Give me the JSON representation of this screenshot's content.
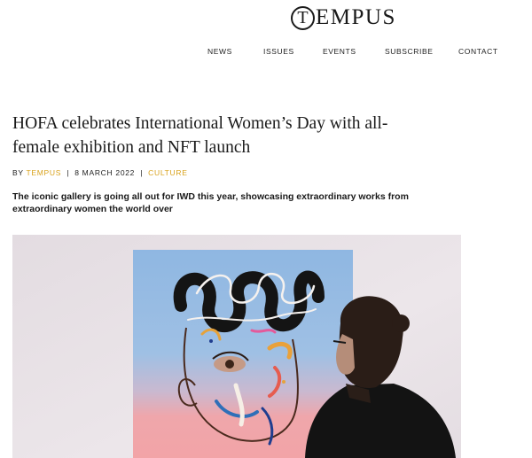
{
  "brand": {
    "logo_initial": "T",
    "logo_rest": "EMPUS"
  },
  "nav": {
    "items": [
      {
        "label": "NEWS"
      },
      {
        "label": "ISSUES"
      },
      {
        "label": "EVENTS"
      },
      {
        "label": "SUBSCRIBE"
      },
      {
        "label": "CONTACT"
      }
    ]
  },
  "article": {
    "title": "HOFA celebrates International Women’s Day with all-female exhibition and NFT launch",
    "byline": {
      "by": "BY",
      "author": "TEMPUS",
      "date": "8 MARCH 2022",
      "category": "CULTURE",
      "separator": "|"
    },
    "standfirst": "The iconic gallery is going all out for IWD this year, showcasing extraordinary works from extraordinary women the world over"
  },
  "colors": {
    "accent": "#d9a21b",
    "text": "#1a1a1a"
  },
  "hero_image": {
    "subject": "man-viewing-painting"
  }
}
